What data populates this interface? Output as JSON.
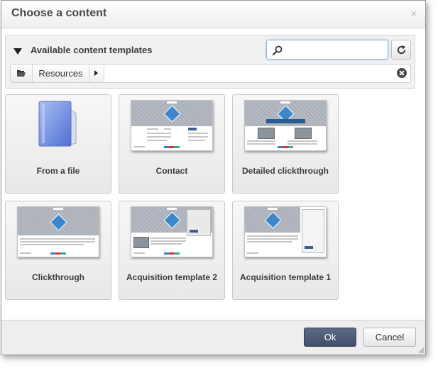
{
  "dialog": {
    "title": "Choose a content",
    "close_icon": "close-icon",
    "close_glyph": "×"
  },
  "panel": {
    "heading": "Available content templates",
    "search": {
      "value": "",
      "placeholder": ""
    },
    "breadcrumb": {
      "folder_icon": "folder-open-icon",
      "item": "Resources"
    }
  },
  "tiles": [
    {
      "label": "From a file",
      "icon": "folder-icon"
    },
    {
      "label": "Contact"
    },
    {
      "label": "Detailed clickthrough"
    },
    {
      "label": "Clickthrough"
    },
    {
      "label": "Acquisition template 2"
    },
    {
      "label": "Acquisition template 1"
    }
  ],
  "footer": {
    "ok_label": "Ok",
    "cancel_label": "Cancel"
  },
  "colors": {
    "primary_button": "#4a5672",
    "thumbnail_accent": "#2d5a93"
  }
}
